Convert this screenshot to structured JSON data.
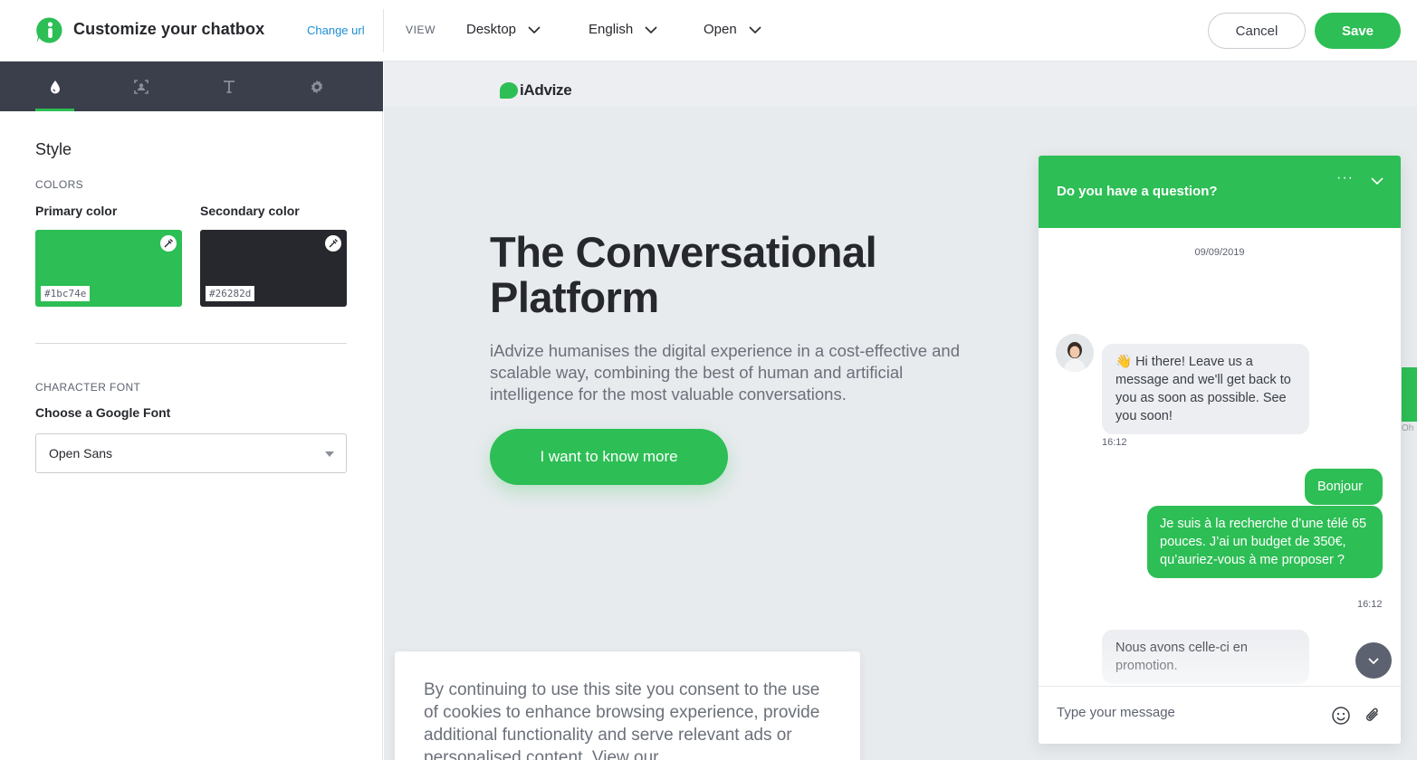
{
  "header": {
    "title": "Customize your chatbox",
    "change_url": "Change url",
    "view_label": "VIEW",
    "device": "Desktop",
    "language": "English",
    "state": "Open",
    "cancel_label": "Cancel",
    "save_label": "Save"
  },
  "left_panel": {
    "tabs": [
      {
        "icon": "drop-icon",
        "active": true
      },
      {
        "icon": "avatar-frame-icon",
        "active": false
      },
      {
        "icon": "text-icon",
        "active": false
      },
      {
        "icon": "gear-icon",
        "active": false
      }
    ],
    "section_title": "Style",
    "colors_heading": "COLORS",
    "primary": {
      "label": "Primary color",
      "hex": "#1bc74e",
      "color": "#2dbe55"
    },
    "secondary": {
      "label": "Secondary color",
      "hex": "#26282d",
      "color": "#26282d"
    },
    "font_heading": "CHARACTER FONT",
    "font_label": "Choose a Google Font",
    "font_value": "Open Sans"
  },
  "preview": {
    "brand": "iAdvize",
    "hero_title": "The Conversational Platform",
    "hero_text": "iAdvize humanises the digital experience in a cost-effective and scalable way, combining the best of human and artificial intelligence for the most valuable conversations.",
    "cta": "I want to know more",
    "cookie_text": "By continuing to use this site you consent to the use of cookies to enhance browsing experience, provide additional functionality and serve relevant ads or personalised content. View our",
    "side_tab_text": "Oh"
  },
  "chat": {
    "header_title": "Do you have a question?",
    "menu_glyph": "···",
    "date": "09/09/2019",
    "messages": [
      {
        "from": "agent",
        "text": "👋 Hi there! Leave us a message and we'll get back to you as soon as possible. See you soon!",
        "time": "16:12"
      },
      {
        "from": "visitor",
        "text": "Bonjour"
      },
      {
        "from": "visitor",
        "text": "Je suis à la recherche d’une télé 65 pouces. J’ai un budget de 350€, qu’auriez-vous à me proposer ?",
        "time": "16:12"
      },
      {
        "from": "agent",
        "text": "Nous avons celle-ci en promotion."
      }
    ],
    "input_placeholder": "Type your message"
  }
}
